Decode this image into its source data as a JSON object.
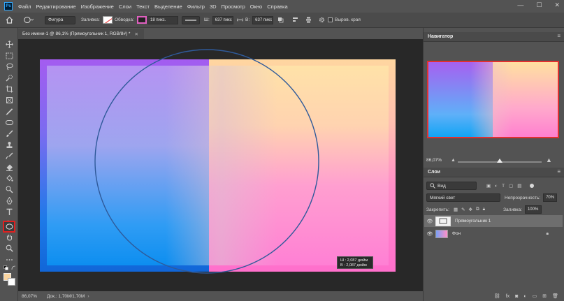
{
  "app": {
    "logo_text": "Ps"
  },
  "menu": [
    "Файл",
    "Редактирование",
    "Изображение",
    "Слои",
    "Текст",
    "Выделение",
    "Фильтр",
    "3D",
    "Просмотр",
    "Окно",
    "Справка"
  ],
  "window_controls": {
    "minimize": "—",
    "maximize": "☐",
    "close": "✕"
  },
  "options_bar": {
    "mode": "Фигура",
    "fill_label": "Заливка:",
    "stroke_label": "Обводка:",
    "stroke_width": "18 пикс.",
    "w_label": "Ш:",
    "w_value": "637 пикс",
    "h_label": "В:",
    "h_value": "637 пикс",
    "align_edges_label": "Выров. края"
  },
  "document": {
    "tab_title": "Без имени-1 @ 86,1% (Прямоугольник 1, RGB/8#) *",
    "close": "✕",
    "size_tip": {
      "w": "Ш :  2,087 дюйм",
      "h": "В :  2,087 дюйм"
    }
  },
  "status": {
    "zoom": "86,07%",
    "doc": "Док.: 1,70M/1,70M"
  },
  "navigator": {
    "title": "Навигатор",
    "zoom": "86,07%"
  },
  "layers": {
    "title": "Слои",
    "filter_kind": "Вид",
    "blend_mode": "Мягкий свет",
    "opacity_label": "Непрозрачность:",
    "opacity_value": "70%",
    "lock_label": "Закрепить:",
    "fill_label": "Заливка:",
    "fill_value": "100%",
    "items": [
      {
        "name": "Прямоугольник 1",
        "selected": true
      },
      {
        "name": "Фон",
        "selected": false
      }
    ]
  },
  "colors": {
    "accent": "#e02020",
    "foreground": "#fad5a0",
    "background": "#ffffff",
    "ellipse_stroke": "#2f5a9a"
  }
}
